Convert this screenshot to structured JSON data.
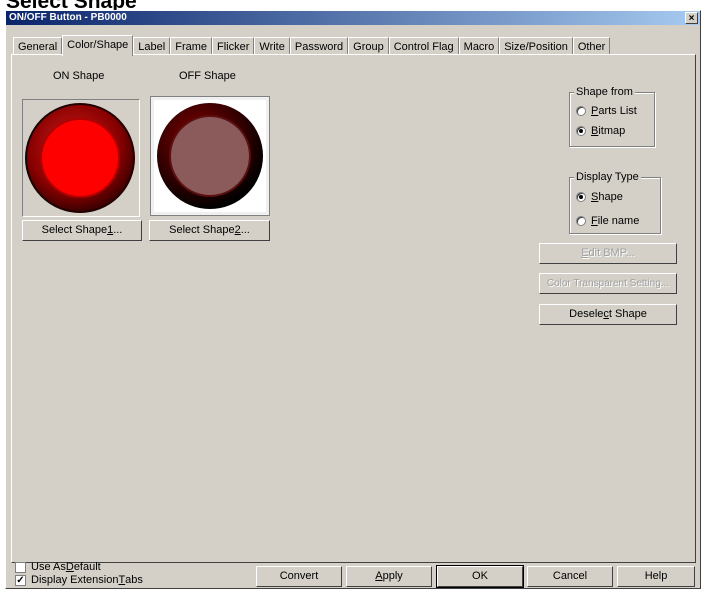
{
  "heading": "Select Shape",
  "window": {
    "title": "ON/OFF Button - PB0000",
    "close": "×"
  },
  "tabs": [
    {
      "label": "General"
    },
    {
      "label": "Color/Shape",
      "active": true
    },
    {
      "label": "Label"
    },
    {
      "label": "Frame"
    },
    {
      "label": "Flicker"
    },
    {
      "label": "Write"
    },
    {
      "label": "Password"
    },
    {
      "label": "Group"
    },
    {
      "label": "Control Flag"
    },
    {
      "label": "Macro"
    },
    {
      "label": "Size/Position"
    },
    {
      "label": "Other"
    }
  ],
  "shapes": {
    "on_label": "ON Shape",
    "off_label": "OFF Shape",
    "select1_pre": "Select Shape",
    "select1_key": "1",
    "select1_post": "...",
    "select2_pre": "Select Shape",
    "select2_key": "2",
    "select2_post": "..."
  },
  "shape_from": {
    "title": "Shape from",
    "parts_key": "P",
    "parts_rest": "arts List",
    "bitmap_key": "B",
    "bitmap_rest": "itmap",
    "selected": "bitmap"
  },
  "display_type": {
    "title": "Display Type",
    "shape_key": "S",
    "shape_rest": "hape",
    "file_key": "F",
    "file_rest": "ile name",
    "selected": "shape"
  },
  "side_buttons": {
    "edit_key": "E",
    "edit_rest": "dit BMP...",
    "color_transparent": "Color Transparent Setting...",
    "deselect_pre": "Desele",
    "deselect_key": "c",
    "deselect_post": "t Shape"
  },
  "checks": {
    "use_default_pre": "Use As ",
    "use_default_key": "D",
    "use_default_post": "efault",
    "use_default_checked": false,
    "ext_tabs_pre": "Display Extension ",
    "ext_tabs_key": "T",
    "ext_tabs_post": "abs",
    "ext_tabs_checked": true,
    "check_mark": "✓"
  },
  "bottom_buttons": {
    "convert": "Convert",
    "apply_key": "A",
    "apply_rest": "pply",
    "ok": "OK",
    "cancel": "Cancel",
    "help": "Help"
  },
  "colors": {
    "on_red": "#ff0000",
    "off_fill": "#8b5a5a",
    "dark_red": "#7a0000",
    "titlebar": "#0a246a"
  }
}
